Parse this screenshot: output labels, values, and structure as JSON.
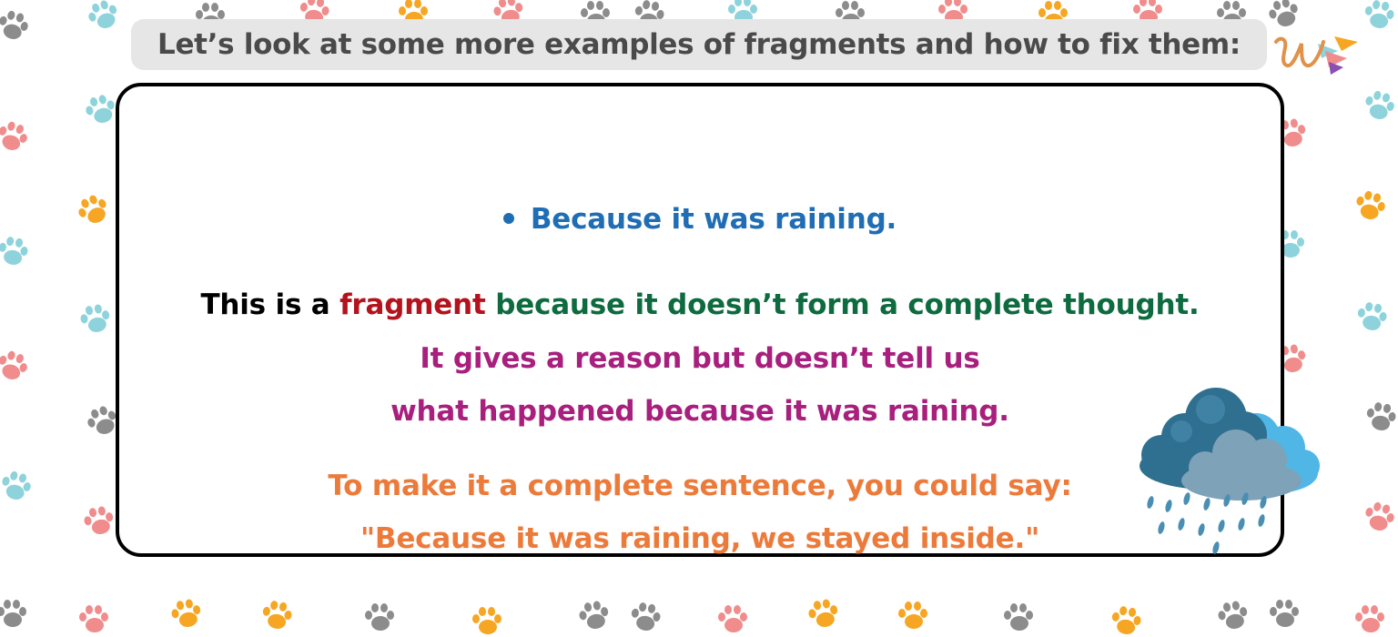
{
  "header": {
    "title": "Let’s look at some more examples of fragments and how to fix them:",
    "logo_icon": "wordsworth-w-logo"
  },
  "card": {
    "bullet": "Because it was raining.",
    "explanation": {
      "part1": "This is a ",
      "part2": "fragment",
      "part3": " because it doesn’t form a complete thought."
    },
    "reason_line1": "It gives a reason but doesn’t tell us",
    "reason_line2": "what happened because it was raining.",
    "fix_line1": "To make it a complete sentence, you could say:",
    "fix_line2": "\"Because it was raining, we stayed inside.\""
  },
  "decor": {
    "background_icon": "paw-print-icon",
    "illustration_icon": "rain-cloud-icon",
    "paw_colors": [
      "#f6a623",
      "#f08c8c",
      "#8ed3dc",
      "#8c8c8c"
    ]
  }
}
